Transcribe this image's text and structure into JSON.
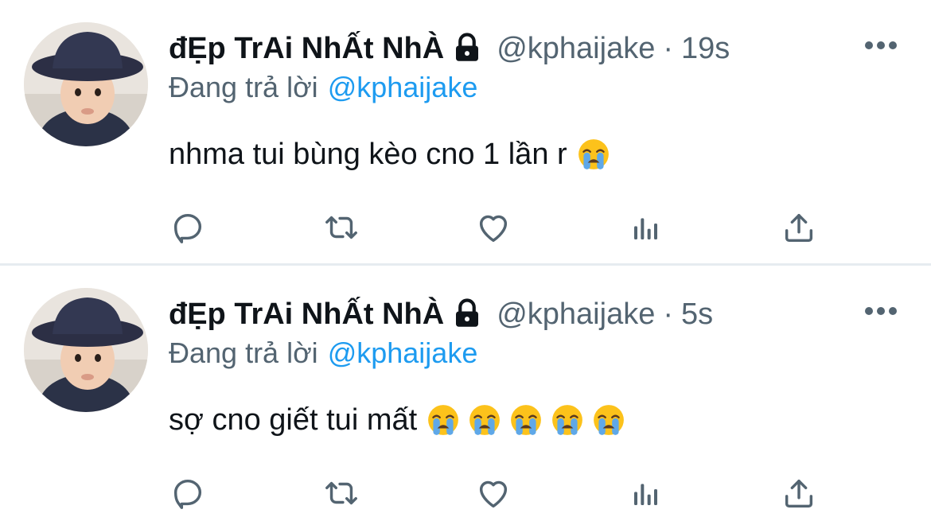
{
  "tweets": [
    {
      "display_name": "đẸp TrAi NhẤt NhÀ",
      "handle": "@kphaijake",
      "separator": "·",
      "time": "19s",
      "reply_prefix": "Đang trả lời",
      "reply_to": "@kphaijake",
      "text": "nhma tui bùng kèo cno 1 lần r",
      "emoji_count": 1,
      "emoji_name": "loudly-crying-face"
    },
    {
      "display_name": "đẸp TrAi NhẤt NhÀ",
      "handle": "@kphaijake",
      "separator": "·",
      "time": "5s",
      "reply_prefix": "Đang trả lời",
      "reply_to": "@kphaijake",
      "text": "sợ cno giết tui mất",
      "emoji_count": 5,
      "emoji_name": "loudly-crying-face"
    }
  ],
  "icons": {
    "lock": "lock-icon",
    "more": "more-icon",
    "reply": "reply-icon",
    "retweet": "retweet-icon",
    "like": "heart-icon",
    "stats": "analytics-icon",
    "share": "share-icon"
  },
  "colors": {
    "text": "#0f1419",
    "secondary": "#536471",
    "link": "#1d9bf0",
    "divider": "#e6ecf0"
  }
}
